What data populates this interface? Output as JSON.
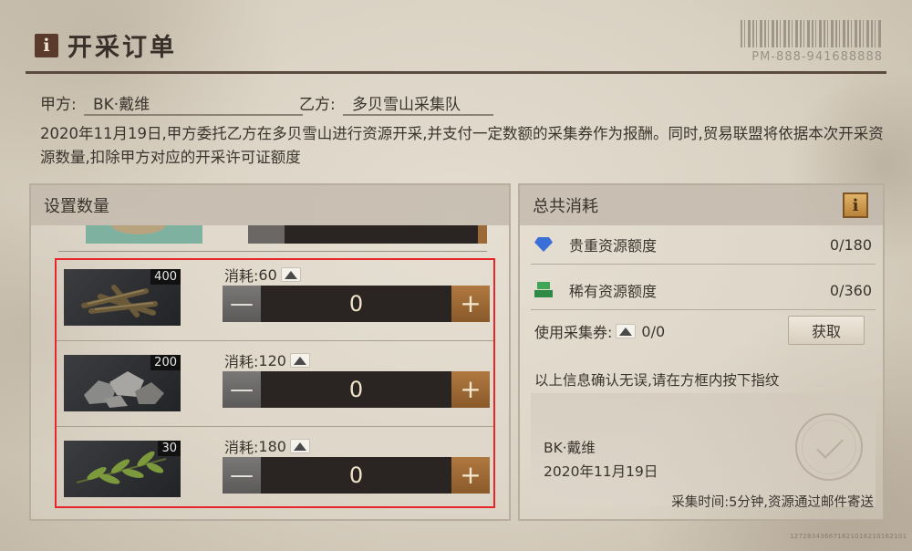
{
  "header": {
    "icon": "info-icon",
    "title": "开采订单",
    "serial": "PM-888-941688888"
  },
  "parties": {
    "a_label": "甲方:",
    "a_value": "BK·戴维",
    "b_label": "乙方:",
    "b_value": "多贝雪山采集队"
  },
  "description": "2020年11月19日,甲方委托乙方在多贝雪山进行资源开采,并支付一定数额的采集券作为报酬。同时,贸易联盟将依据本次开采资源数量,扣除甲方对应的开采许可证额度",
  "quantity_panel": {
    "title": "设置数量",
    "cost_prefix": "消耗:",
    "items": [
      {
        "name": "wood",
        "count": "400",
        "cost": "60",
        "quantity": "0"
      },
      {
        "name": "stone",
        "count": "200",
        "cost": "120",
        "quantity": "0"
      },
      {
        "name": "herb",
        "count": "30",
        "cost": "180",
        "quantity": "0"
      }
    ],
    "minus_symbol": "—",
    "plus_symbol": "+"
  },
  "total_panel": {
    "title": "总共消耗",
    "icon": "info-icon",
    "precious_label": "贵重资源额度",
    "precious_value": "0/180",
    "rare_label": "稀有资源额度",
    "rare_value": "0/360",
    "ticket_label": "使用采集券:",
    "ticket_value": "0/0",
    "get_button": "获取",
    "confirm_text": "以上信息确认无误,请在方框内按下指纹",
    "sig_name": "BK·戴维",
    "sig_date": "2020年11月19日",
    "collect_time": "采集时间:5分钟,资源通过邮件寄送"
  },
  "footer_serial": "127283436671621016210162101"
}
